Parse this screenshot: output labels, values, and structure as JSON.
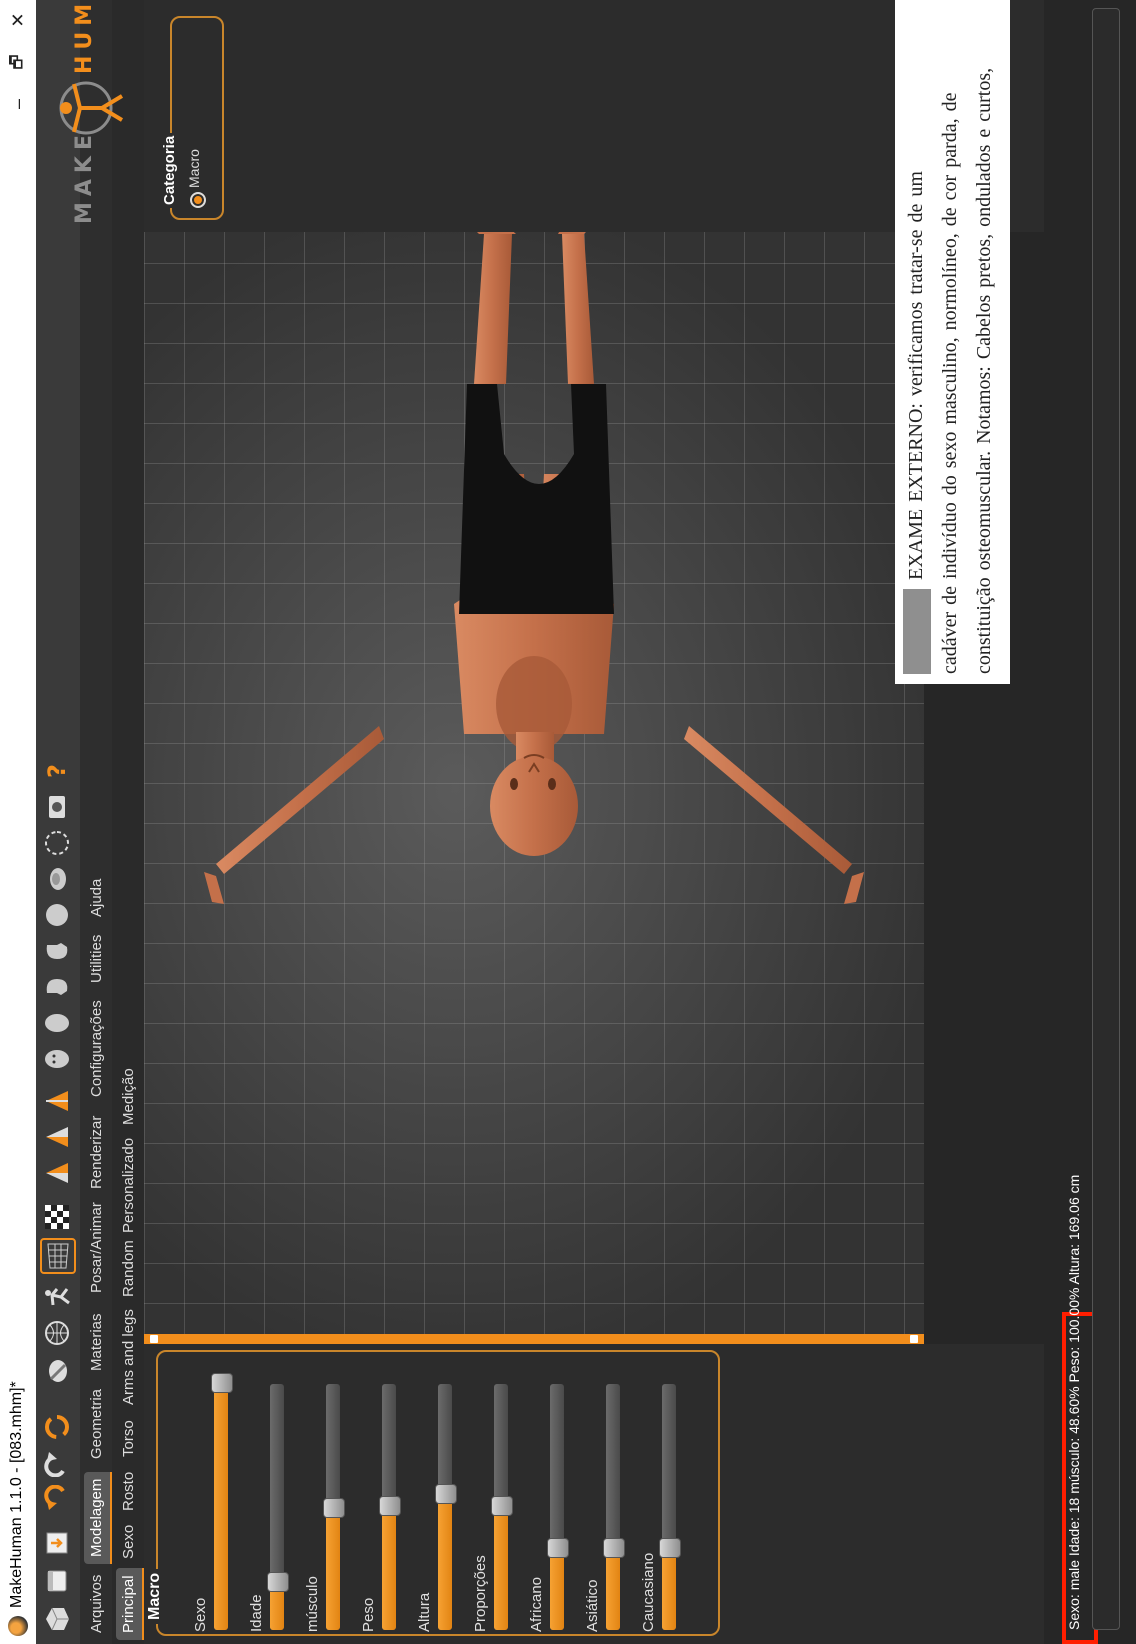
{
  "window": {
    "title": "MakeHuman 1.1.0 - [083.mhm]*",
    "minimize_glyph": "–",
    "restore_glyph": "🗗",
    "close_glyph": "✕"
  },
  "main_tabs": [
    {
      "label": "Arquivos",
      "active": false
    },
    {
      "label": "Modelagem",
      "active": true
    },
    {
      "label": "Geometria",
      "active": false
    },
    {
      "label": "Materias",
      "active": false
    },
    {
      "label": "Posar/Animar",
      "active": false
    },
    {
      "label": "Renderizar",
      "active": false
    },
    {
      "label": "Configurações",
      "active": false
    },
    {
      "label": "Utilities",
      "active": false
    },
    {
      "label": "Ajuda",
      "active": false
    }
  ],
  "sub_tabs": [
    {
      "label": "Principal",
      "active": true
    },
    {
      "label": "Sexo",
      "active": false
    },
    {
      "label": "Rosto",
      "active": false
    },
    {
      "label": "Torso",
      "active": false
    },
    {
      "label": "Arms and legs",
      "active": false
    },
    {
      "label": "Random",
      "active": false
    },
    {
      "label": "Personalizado",
      "active": false
    },
    {
      "label": "Medição",
      "active": false
    }
  ],
  "macro": {
    "title": "Macro",
    "sliders": [
      {
        "label": "Sexo",
        "value": 1.0
      },
      {
        "label": "Idade",
        "value": 0.19
      },
      {
        "label": "músculo",
        "value": 0.49
      },
      {
        "label": "Peso",
        "value": 0.5
      },
      {
        "label": "Altura",
        "value": 0.55
      },
      {
        "label": "Proporções",
        "value": 0.5
      },
      {
        "label": "Africano",
        "value": 0.33
      },
      {
        "label": "Asiático",
        "value": 0.33
      },
      {
        "label": "Caucasiano",
        "value": 0.33
      }
    ]
  },
  "right_panel": {
    "category_title": "Categoria",
    "option": "Macro"
  },
  "logo": {
    "left": "MAKE",
    "right": "HUMAN"
  },
  "overlay_doc": {
    "line1": "EXAME EXTERNO: verificamos tratar-se de um",
    "line2": "cadáver de indivíduo do sexo masculino, normolíneo, de cor parda, de",
    "line3": "constituição osteomuscular. Notamos: Cabelos pretos, ondulados e curtos,"
  },
  "status": {
    "text": "Sexo: male Idade: 18 músculo: 48.60% Peso: 100.00% Altura: 169.06 cm"
  },
  "colors": {
    "accent": "#f28e1c",
    "highlight": "#ff1e00",
    "bg": "#262626"
  }
}
